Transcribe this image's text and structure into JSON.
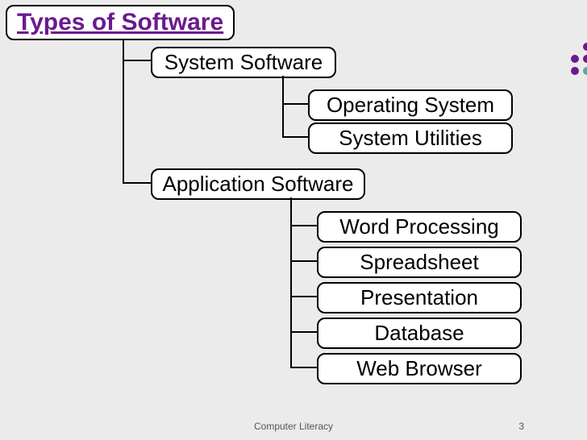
{
  "title": "Types of Software",
  "nodes": {
    "system": "System Software",
    "os": "Operating System",
    "utilities": "System Utilities",
    "application": "Application Software",
    "word": "Word Processing",
    "spreadsheet": "Spreadsheet",
    "presentation": "Presentation",
    "database": "Database",
    "browser": "Web Browser"
  },
  "footer": {
    "subject": "Computer Literacy",
    "page": "3"
  }
}
